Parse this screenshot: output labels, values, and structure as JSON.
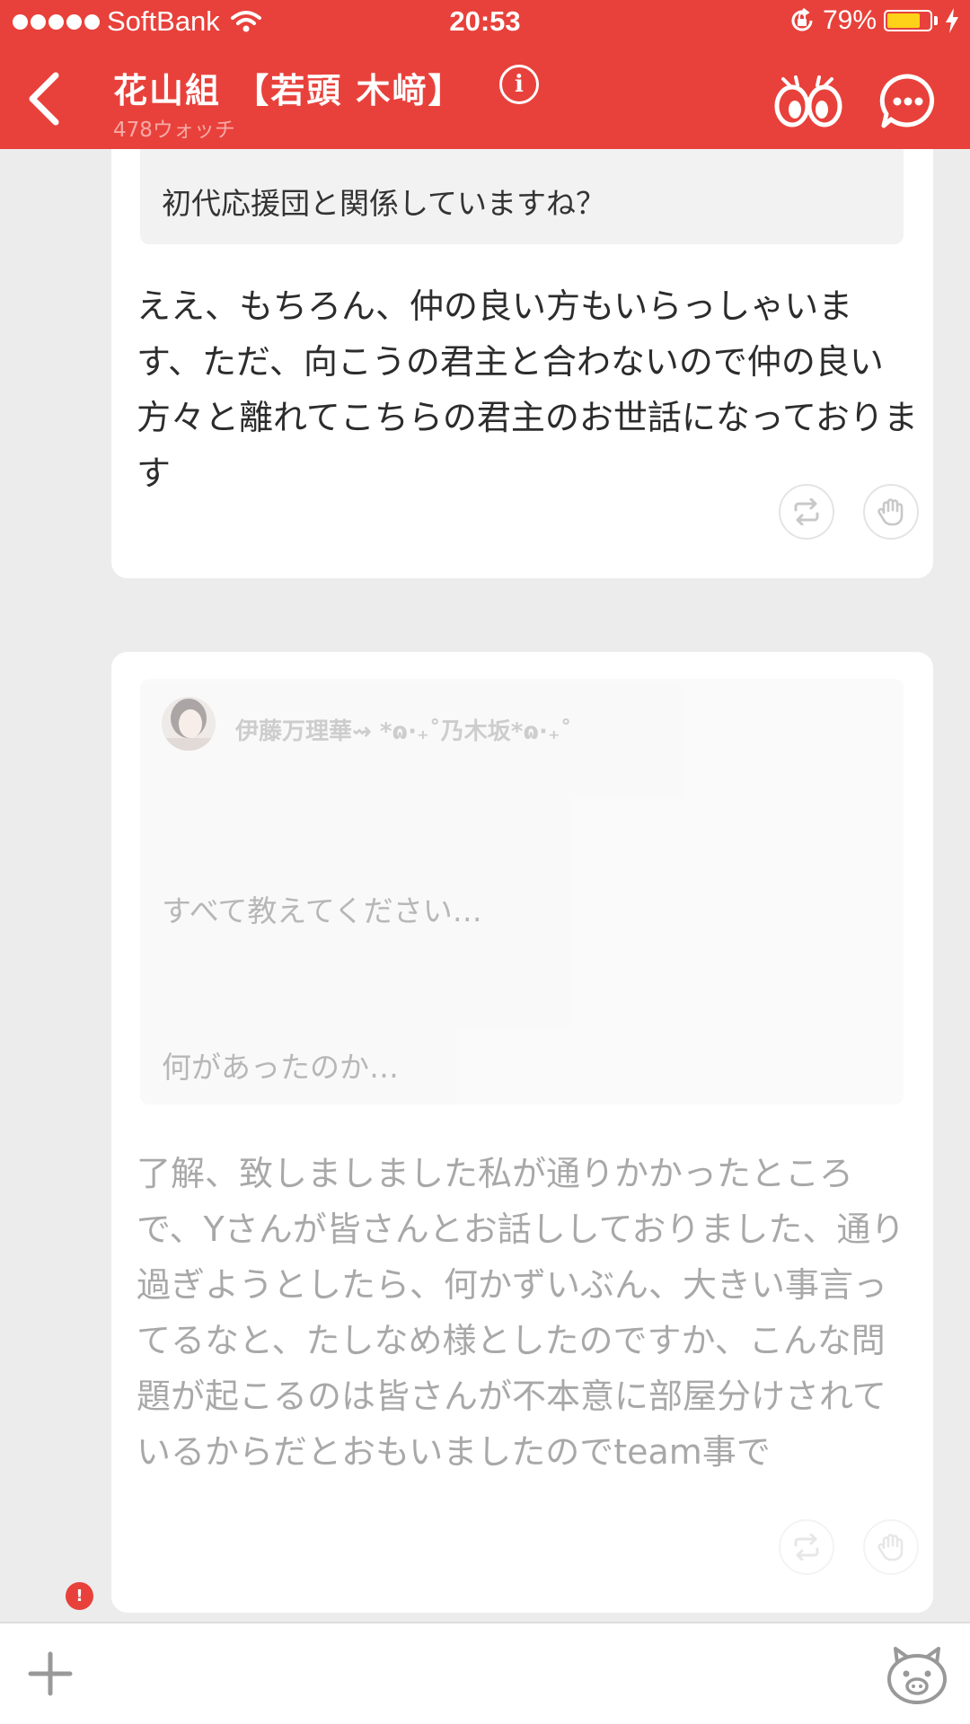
{
  "status_bar": {
    "carrier": "SoftBank",
    "time": "20:53",
    "battery_percent": "79%",
    "battery_level": 0.79,
    "icons": [
      "signal-dots-icon",
      "wifi-icon",
      "rotation-lock-icon",
      "battery-icon",
      "charging-bolt-icon"
    ]
  },
  "header": {
    "title": "花山組 【若頭 木﨑】",
    "subtitle": "478ウォッチ",
    "icons": [
      "back-chevron-icon",
      "info-icon",
      "watch-eyes-icon",
      "chat-bubble-icon"
    ]
  },
  "posts": [
    {
      "quote_text": "初代応援団と関係していますね？",
      "body": "ええ、もちろん、仲の良い方もいらっしゃいます、ただ、向こうの君主と合わないので仲の良い方々と離れてこちらの君主のお世話になっております"
    },
    {
      "quote_user": "伊藤万理華⇝ *ɷ·₊˚乃木坂*ɷ·₊˚",
      "quote_line1": "すべて教えてください…",
      "quote_line2": "何があったのか…",
      "body": "了解、致しましました私が通りかかったところで、Yさんが皆さんとお話ししておりました、通り過ぎようとしたら、何かずいぶん、大きい事言ってるなと、たしなめ様としたのですか、こんな問題が起こるのは皆さんが不本意に部屋分けされているからだとおもいましたのでteam事で"
    }
  ],
  "actions": [
    "repost-icon",
    "clap-hand-icon"
  ],
  "notification_badge": "!",
  "input_bar": {
    "icons": [
      "plus-icon",
      "pig-stamp-icon"
    ]
  },
  "colors": {
    "brand": "#e8413b",
    "background": "#ececec",
    "card": "#ffffff",
    "quote_box": "#f2f2f2"
  }
}
